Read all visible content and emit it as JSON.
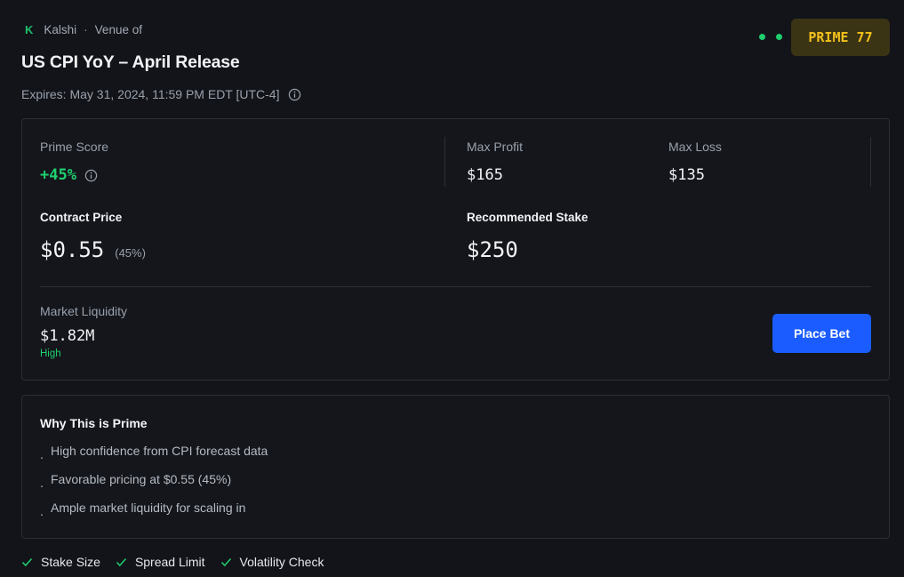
{
  "header": {
    "venue_logo": "K",
    "venue_name": "Kalshi",
    "venue_suffix": "Venue of",
    "title": "US CPI YoY – April Release",
    "expires": "Expires: May 31, 2024, 11:59 PM EDT [UTC-4]",
    "prime_badge": "PRIME 77"
  },
  "metrics": {
    "prime_score_label": "Prime Score",
    "prime_score_value": "+45%",
    "max_profit_label": "Max Profit",
    "max_profit_value": "$165",
    "max_loss_label": "Max Loss",
    "max_loss_value": "$135",
    "contract_price_label": "Contract Price",
    "contract_price_value": "$0.55",
    "contract_price_pct": "(45%)",
    "recommended_stake_label": "Recommended Stake",
    "recommended_stake_value": "$250",
    "liquidity_label": "Market Liquidity",
    "liquidity_value": "$1.82M",
    "liquidity_level": "High",
    "place_bet_label": "Place Bet"
  },
  "why": {
    "title": "Why This is Prime",
    "reasons": [
      "High confidence from CPI forecast data",
      "Favorable pricing at $0.55 (45%)",
      "Ample market liquidity for scaling in"
    ]
  },
  "checks": [
    "Stake Size",
    "Spread Limit",
    "Volatility Check"
  ],
  "colors": {
    "background": "#12141a",
    "accent_green": "#1fcf6e",
    "accent_blue": "#1a5cff",
    "badge_bg": "#3b3414",
    "badge_text": "#f2c01c"
  }
}
